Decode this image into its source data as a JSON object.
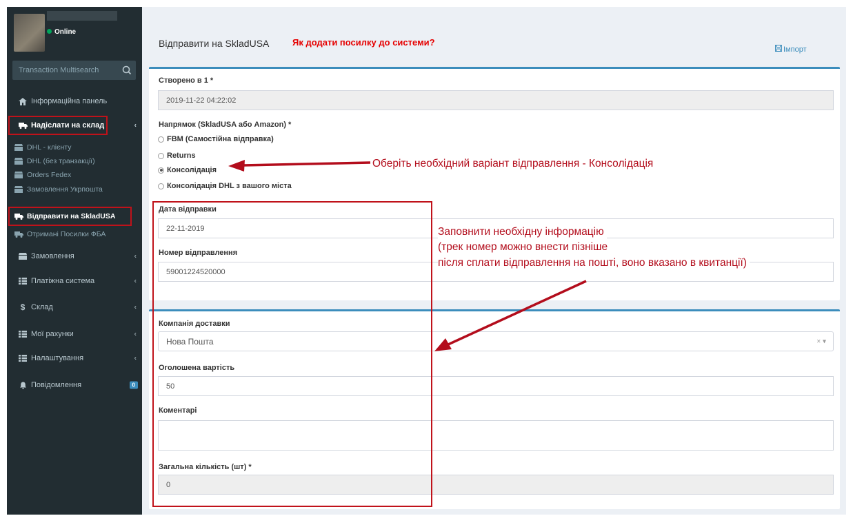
{
  "sidebar": {
    "status": "Online",
    "search_placeholder": "Transaction Multisearch",
    "items": [
      {
        "label": "Інформаційна панель"
      },
      {
        "label": "Надіслати на склад"
      },
      {
        "label": "DHL - клієнту"
      },
      {
        "label": "DHL (без транзакції)"
      },
      {
        "label": "Orders Fedex"
      },
      {
        "label": "Замовлення Укрпошта"
      },
      {
        "label": "Відправити на SkladUSA"
      },
      {
        "label": "Отримані Посилки ФБА"
      },
      {
        "label": "Замовлення"
      },
      {
        "label": "Платіжна система"
      },
      {
        "label": "Склад"
      },
      {
        "label": "Мої рахунки"
      },
      {
        "label": "Налаштування"
      },
      {
        "label": "Повідомлення",
        "badge": "0"
      }
    ]
  },
  "header": {
    "title": "Відправити на SkladUSA",
    "help_link": "Як додати посилку до системи?",
    "import_label": "Імпорт"
  },
  "form": {
    "created_label": "Створено в 1 *",
    "created_value": "2019-11-22 04:22:02",
    "direction_label": "Напрямок (SkladUSA або Amazon) *",
    "options": [
      "FBM (Самостійна відправка)",
      "Returns",
      "Консолідація",
      "Консолідація DHL з вашого міста"
    ],
    "selected_option": "Консолідація",
    "ship_date_label": "Дата відправки",
    "ship_date_value": "22-11-2019",
    "tracking_label": "Номер відправлення",
    "tracking_value": "59001224520000",
    "carrier_label": "Компанія доставки",
    "carrier_value": "Нова Пошта",
    "declared_label": "Оголошена вартість",
    "declared_value": "50",
    "comments_label": "Коментарі",
    "comments_value": "",
    "total_label": "Загальна кількість (шт) *",
    "total_value": "0"
  },
  "annotations": {
    "choose": "Оберіть необхідний варіант відправлення  - Консолідація",
    "fill_line1": "Заповнити необхідну інформацію",
    "fill_line2": "(трек номер можно внести пізніше",
    "fill_line3": "після сплати відправлення на пошті, воно вказано в квитанції)"
  },
  "colors": {
    "sidebar_bg": "#222d32",
    "accent": "#3c8dbc",
    "annotation_red": "#b30d1c",
    "online_green": "#00a65a"
  }
}
